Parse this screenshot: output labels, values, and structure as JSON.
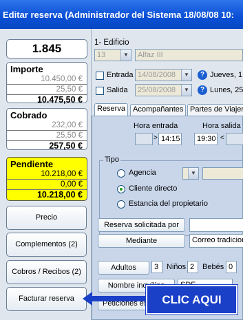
{
  "window": {
    "title": "Editar reserva  (Administrador del Sistema 18/08/08 10:"
  },
  "summary": {
    "number": "1.845",
    "importe": {
      "title": "Importe",
      "lines": [
        "10.450,00 €",
        "25,50 €"
      ],
      "total": "10.475,50 €"
    },
    "cobrado": {
      "title": "Cobrado",
      "lines": [
        "232,00 €",
        "25,50 €"
      ],
      "total": "257,50 €"
    },
    "pendiente": {
      "title": "Pendiente",
      "lines": [
        "10.218,00 €",
        "0,00 €"
      ],
      "total": "10.218,00 €"
    }
  },
  "buttons": {
    "precio": "Precio",
    "complementos": "Complementos (2)",
    "cobros": "Cobros / Recibos (2)",
    "facturar": "Facturar reserva"
  },
  "edificio": {
    "label": "1- Edificio",
    "code": "13",
    "name": "Alfaz III"
  },
  "entrada": {
    "label": "Entrada",
    "date": "14/08/2008",
    "day": "Jueves, 1"
  },
  "salida": {
    "label": "Salida",
    "date": "25/08/2008",
    "day": "Lunes, 25"
  },
  "tabs": [
    "Reserva",
    "Acompañantes",
    "Partes de Viajero"
  ],
  "horas": {
    "entrada_label": "Hora entrada",
    "entrada_value": "14:15",
    "salida_label": "Hora salida",
    "salida_value": "19:30"
  },
  "tipo": {
    "label": "Tipo",
    "options": [
      "Agencia",
      "Cliente directo",
      "Estancia del propietario"
    ],
    "selected": "Cliente directo"
  },
  "solicitada": {
    "label": "Reserva solicitada por",
    "value": ""
  },
  "mediante": {
    "label": "Mediante",
    "value": "Correo tradicion"
  },
  "ocupantes": {
    "adultos_label": "Adultos",
    "adultos": "3",
    "ninos_label": "Niños",
    "ninos": "2",
    "bebes_label": "Bebés",
    "bebes": "0"
  },
  "nombre": {
    "label": "Nombre inquilino",
    "value": "SDF"
  },
  "peticiones": {
    "label": "Peticiones es"
  },
  "callout": {
    "text": "CLIC AQUI",
    "color": "#1b40c8"
  }
}
